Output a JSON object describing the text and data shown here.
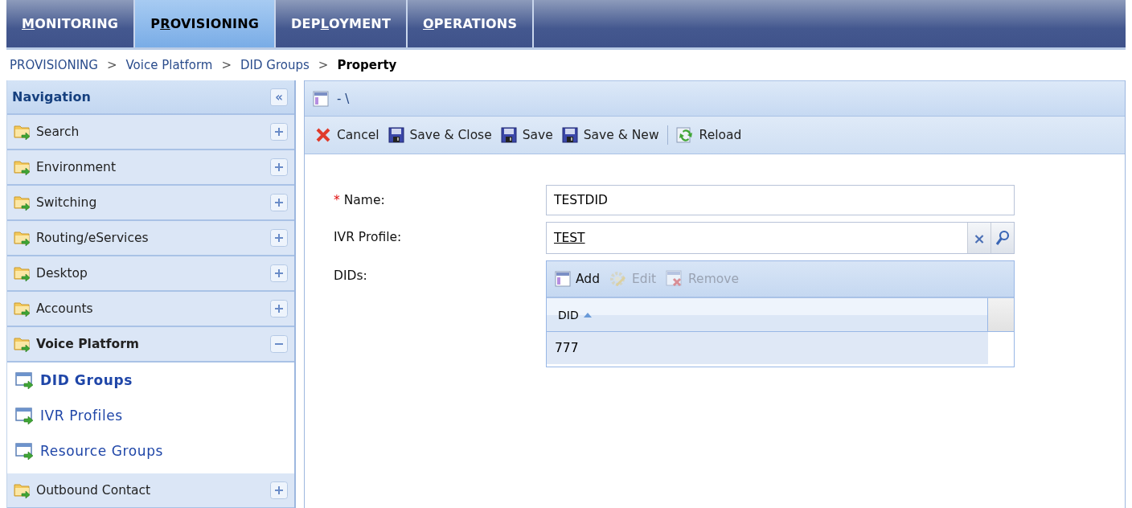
{
  "tabs": [
    {
      "label": [
        {
          "text": "M",
          "underlined": true
        },
        {
          "text": "ONITORING",
          "underlined": false
        }
      ],
      "selected": false
    },
    {
      "label": [
        {
          "text": "P",
          "underlined": false
        },
        {
          "text": "R",
          "underlined": true
        },
        {
          "text": "OVISIONING",
          "underlined": false
        }
      ],
      "selected": true
    },
    {
      "label": [
        {
          "text": "DEP",
          "underlined": false
        },
        {
          "text": "L",
          "underlined": true
        },
        {
          "text": "OYMENT",
          "underlined": false
        }
      ],
      "selected": false
    },
    {
      "label": [
        {
          "text": "O",
          "underlined": true
        },
        {
          "text": "PERATIONS",
          "underlined": false
        }
      ],
      "selected": false
    }
  ],
  "breadcrumb": {
    "items": [
      "PROVISIONING",
      "Voice Platform",
      "DID Groups"
    ],
    "separator": ">",
    "current": "Property"
  },
  "navigation": {
    "title": "Navigation",
    "collapse_button": "«",
    "sections": [
      {
        "label": "Search",
        "expanded": false
      },
      {
        "label": "Environment",
        "expanded": false
      },
      {
        "label": "Switching",
        "expanded": false
      },
      {
        "label": "Routing/eServices",
        "expanded": false
      },
      {
        "label": "Desktop",
        "expanded": false
      },
      {
        "label": "Accounts",
        "expanded": false
      },
      {
        "label": "Voice Platform",
        "expanded": true,
        "children": [
          {
            "label": "DID Groups",
            "selected": true
          },
          {
            "label": "IVR Profiles",
            "selected": false
          },
          {
            "label": "Resource Groups",
            "selected": false
          }
        ]
      },
      {
        "label": "Outbound Contact",
        "expanded": false
      }
    ]
  },
  "panel": {
    "title": "- \\",
    "toolbar": [
      {
        "kind": "cancel",
        "label": "Cancel"
      },
      {
        "kind": "save",
        "label": "Save & Close"
      },
      {
        "kind": "save",
        "label": "Save"
      },
      {
        "kind": "save",
        "label": "Save & New"
      },
      {
        "kind": "separator"
      },
      {
        "kind": "reload",
        "label": "Reload"
      }
    ],
    "form": {
      "name": {
        "label": "Name:",
        "required": true,
        "required_mark": "*",
        "value": "TESTDID"
      },
      "ivr_profile": {
        "label": "IVR Profile:",
        "value": "TEST",
        "clear_button": "×"
      },
      "dids": {
        "label": "DIDs:",
        "toolbar": [
          {
            "kind": "add",
            "label": "Add",
            "disabled": false
          },
          {
            "kind": "edit",
            "label": "Edit",
            "disabled": true
          },
          {
            "kind": "remove",
            "label": "Remove",
            "disabled": true
          }
        ],
        "columns": [
          {
            "label": "DID",
            "sorted_ascending": true
          }
        ],
        "rows": [
          {
            "cells": [
              "777"
            ],
            "selected": true
          }
        ]
      }
    }
  }
}
